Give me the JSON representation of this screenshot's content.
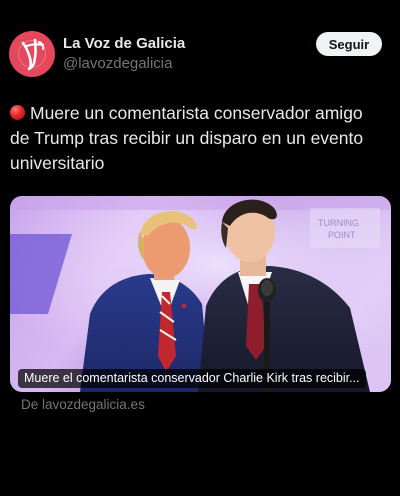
{
  "account": {
    "name": "La Voz de Galicia",
    "handle": "@lavozdegalicia",
    "avatar_color": "#e5485c"
  },
  "follow_button": {
    "label": "Seguir"
  },
  "post": {
    "emoji": "red-circle-emoji",
    "text": "Muere un comentarista conservador amigo de Trump tras recibir un disparo en un evento universitario"
  },
  "media": {
    "caption": "Muere el comentarista conservador Charlie Kirk tras recibir...",
    "source": "De lavozdegalicia.es"
  },
  "colors": {
    "background": "#000000",
    "text_primary": "#e7e9ea",
    "text_secondary": "#71767b",
    "button_bg": "#eff3f4"
  }
}
